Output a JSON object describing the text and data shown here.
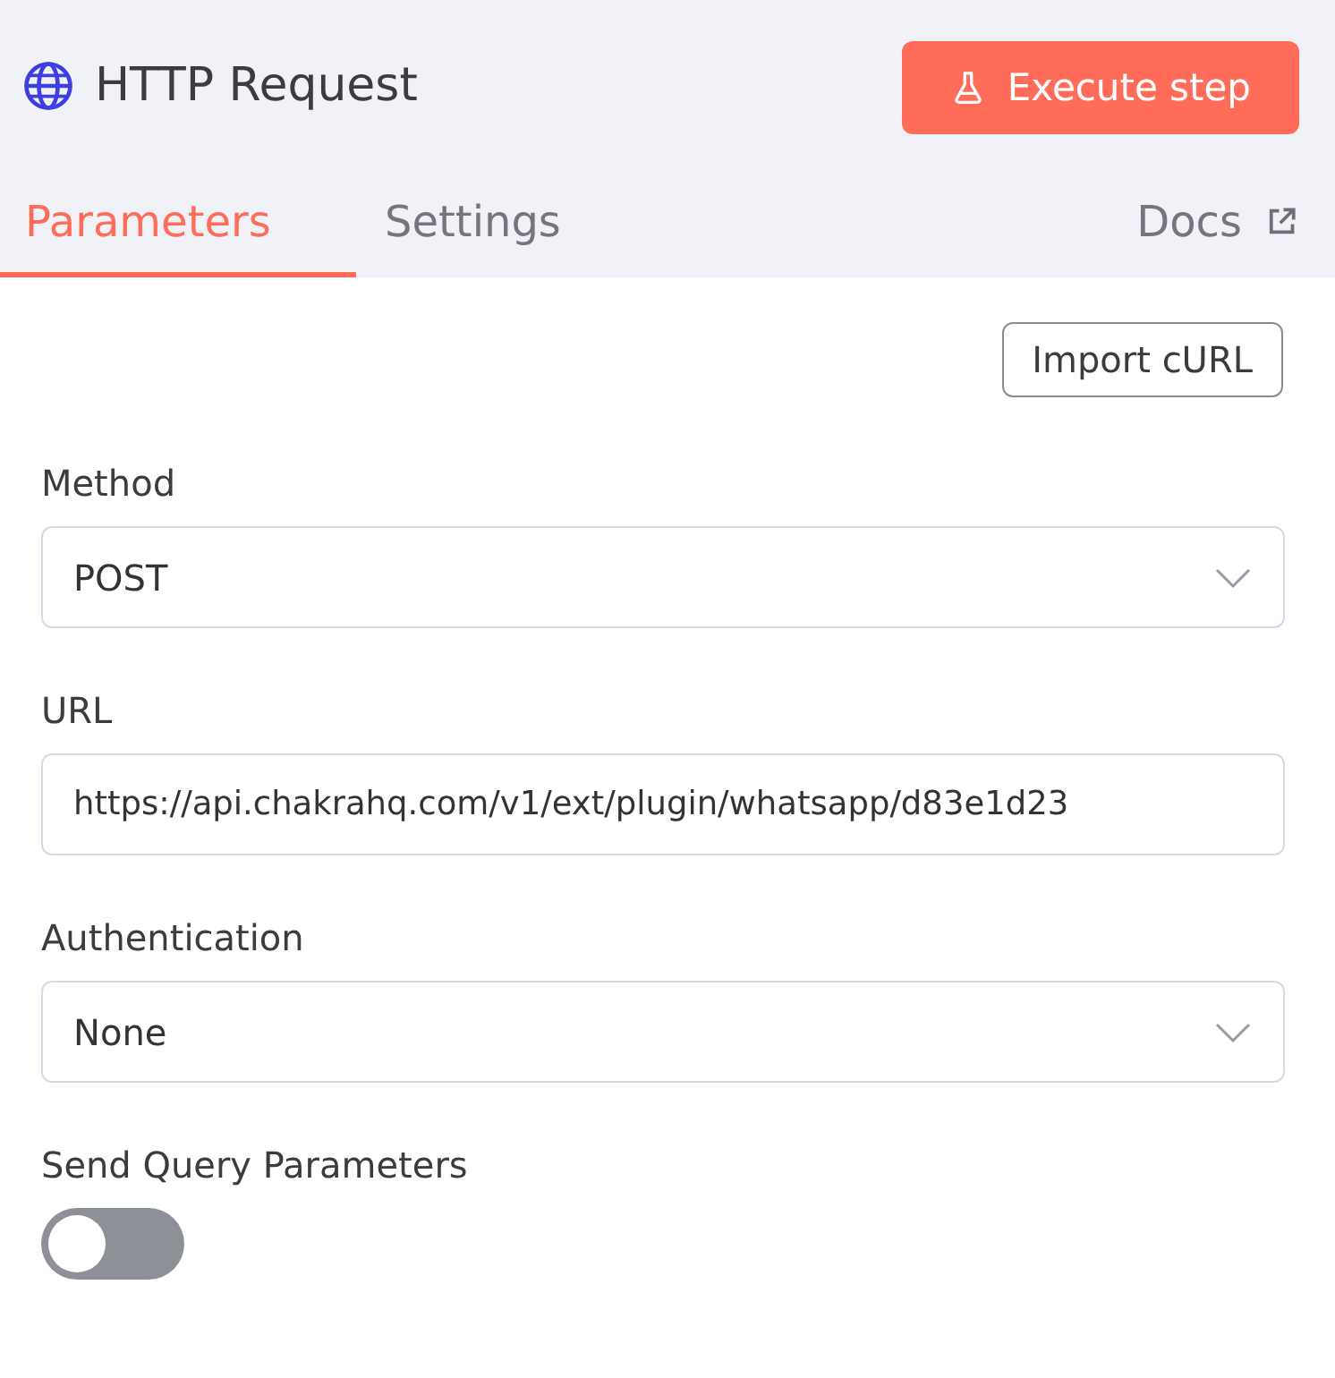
{
  "header": {
    "title": "HTTP Request",
    "execute_button": "Execute step"
  },
  "tabs": [
    {
      "label": "Parameters",
      "selected": true
    },
    {
      "label": "Settings",
      "selected": false
    }
  ],
  "docs_link": "Docs",
  "import_button": "Import cURL",
  "fields": [
    {
      "kind": "select",
      "label": "Method",
      "value": "POST"
    },
    {
      "kind": "text",
      "label": "URL",
      "value": "https://api.chakrahq.com/v1/ext/plugin/whatsapp/d83e1d23"
    },
    {
      "kind": "select",
      "label": "Authentication",
      "value": "None"
    },
    {
      "kind": "toggle",
      "label": "Send Query Parameters",
      "on": false
    }
  ]
}
